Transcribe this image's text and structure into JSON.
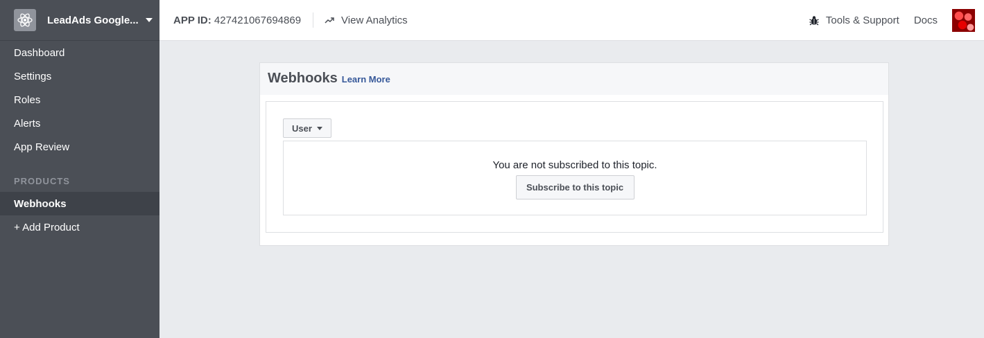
{
  "sidebar": {
    "app_name": "LeadAds Google...",
    "items": [
      {
        "label": "Dashboard"
      },
      {
        "label": "Settings"
      },
      {
        "label": "Roles"
      },
      {
        "label": "Alerts"
      },
      {
        "label": "App Review"
      }
    ],
    "products_header": "PRODUCTS",
    "products": [
      {
        "label": "Webhooks",
        "active": true
      },
      {
        "label": "+ Add Product"
      }
    ]
  },
  "topbar": {
    "app_id_label": "APP ID:",
    "app_id_value": "427421067694869",
    "analytics_label": "View Analytics",
    "tools_label": "Tools & Support",
    "docs_label": "Docs"
  },
  "panel": {
    "title": "Webhooks",
    "learn_more": "Learn More",
    "topic_selected": "User",
    "status_text": "You are not subscribed to this topic.",
    "subscribe_label": "Subscribe to this topic"
  },
  "colors": {
    "sidebar_bg": "#4b4f56",
    "active_bg": "#3e4249",
    "link": "#365899",
    "page_bg": "#e9ebee"
  }
}
